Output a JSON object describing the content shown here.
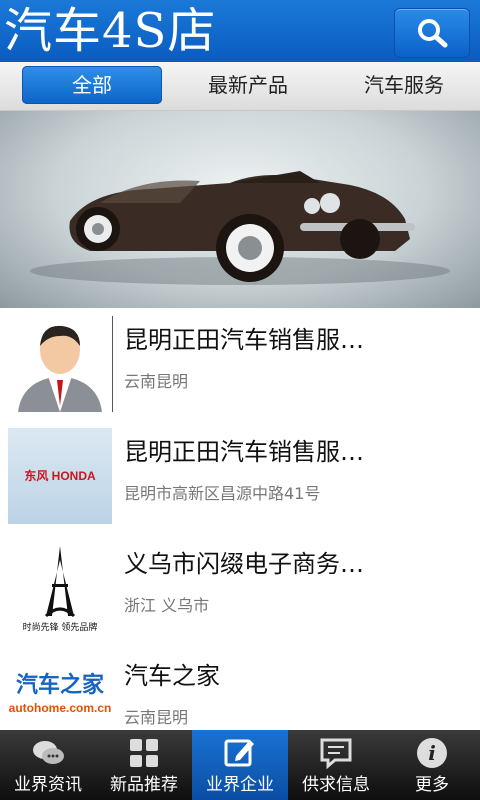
{
  "header": {
    "title": "汽车4S店"
  },
  "tabs": [
    {
      "label": "全部",
      "active": true
    },
    {
      "label": "最新产品",
      "active": false
    },
    {
      "label": "汽车服务",
      "active": false
    }
  ],
  "list": [
    {
      "title": "昆明正田汽车销售服…",
      "subtitle": "云南昆明",
      "thumb": "person-avatar"
    },
    {
      "title": "昆明正田汽车销售服…",
      "subtitle": "昆明市高新区昌源中路41号",
      "thumb": "honda-logo",
      "logo_text": "东风 HONDA"
    },
    {
      "title": "义乌市闪缀电子商务…",
      "subtitle": "浙江 义乌市",
      "thumb": "eiffel-tower-logo",
      "logo_text": "时尚先锋 领先品牌"
    },
    {
      "title": "汽车之家",
      "subtitle": "云南昆明",
      "thumb": "autohome-logo",
      "logo_text": "汽车之家 autohome.com.cn"
    }
  ],
  "bottom_nav": [
    {
      "label": "业界资讯",
      "icon": "chat-bubbles-icon",
      "active": false
    },
    {
      "label": "新品推荐",
      "icon": "grid-icon",
      "active": false
    },
    {
      "label": "业界企业",
      "icon": "edit-icon",
      "active": true
    },
    {
      "label": "供求信息",
      "icon": "message-icon",
      "active": false
    },
    {
      "label": "更多",
      "icon": "info-icon",
      "active": false
    }
  ],
  "colors": {
    "header_blue": "#0a5cc0",
    "tab_active": "#1b79d8",
    "nav_active": "#1a72d4"
  }
}
